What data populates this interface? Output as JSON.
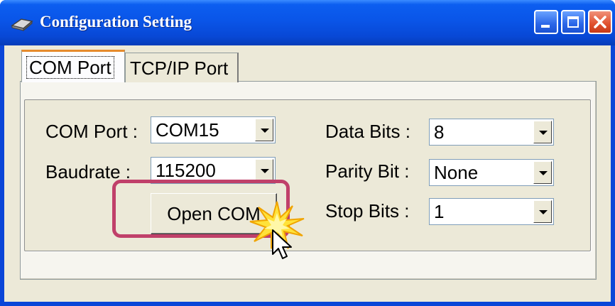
{
  "window": {
    "title": "Configuration Setting",
    "icons": {
      "app": "modem-icon",
      "minimize": "minimize-icon",
      "maximize": "maximize-icon",
      "close": "close-icon"
    }
  },
  "tabs": [
    {
      "label": "COM Port",
      "active": true
    },
    {
      "label": "TCP/IP Port",
      "active": false
    }
  ],
  "form": {
    "com_port": {
      "label": "COM Port :",
      "value": "COM15"
    },
    "baudrate": {
      "label": "Baudrate :",
      "value": "115200"
    },
    "data_bits": {
      "label": "Data Bits :",
      "value": "8"
    },
    "parity_bit": {
      "label": "Parity Bit :",
      "value": "None"
    },
    "stop_bits": {
      "label": "Stop Bits :",
      "value": "1"
    }
  },
  "actions": {
    "open_com": "Open COM"
  },
  "annotations": {
    "highlight_color": "#c0406a",
    "cursor": "arrow-cursor-icon",
    "click_effect": "click-spark-icon"
  },
  "colors": {
    "titlebar": "#0a55e8",
    "dialog_bg": "#ece9d8",
    "active_tab_accent": "#e68b2c"
  }
}
